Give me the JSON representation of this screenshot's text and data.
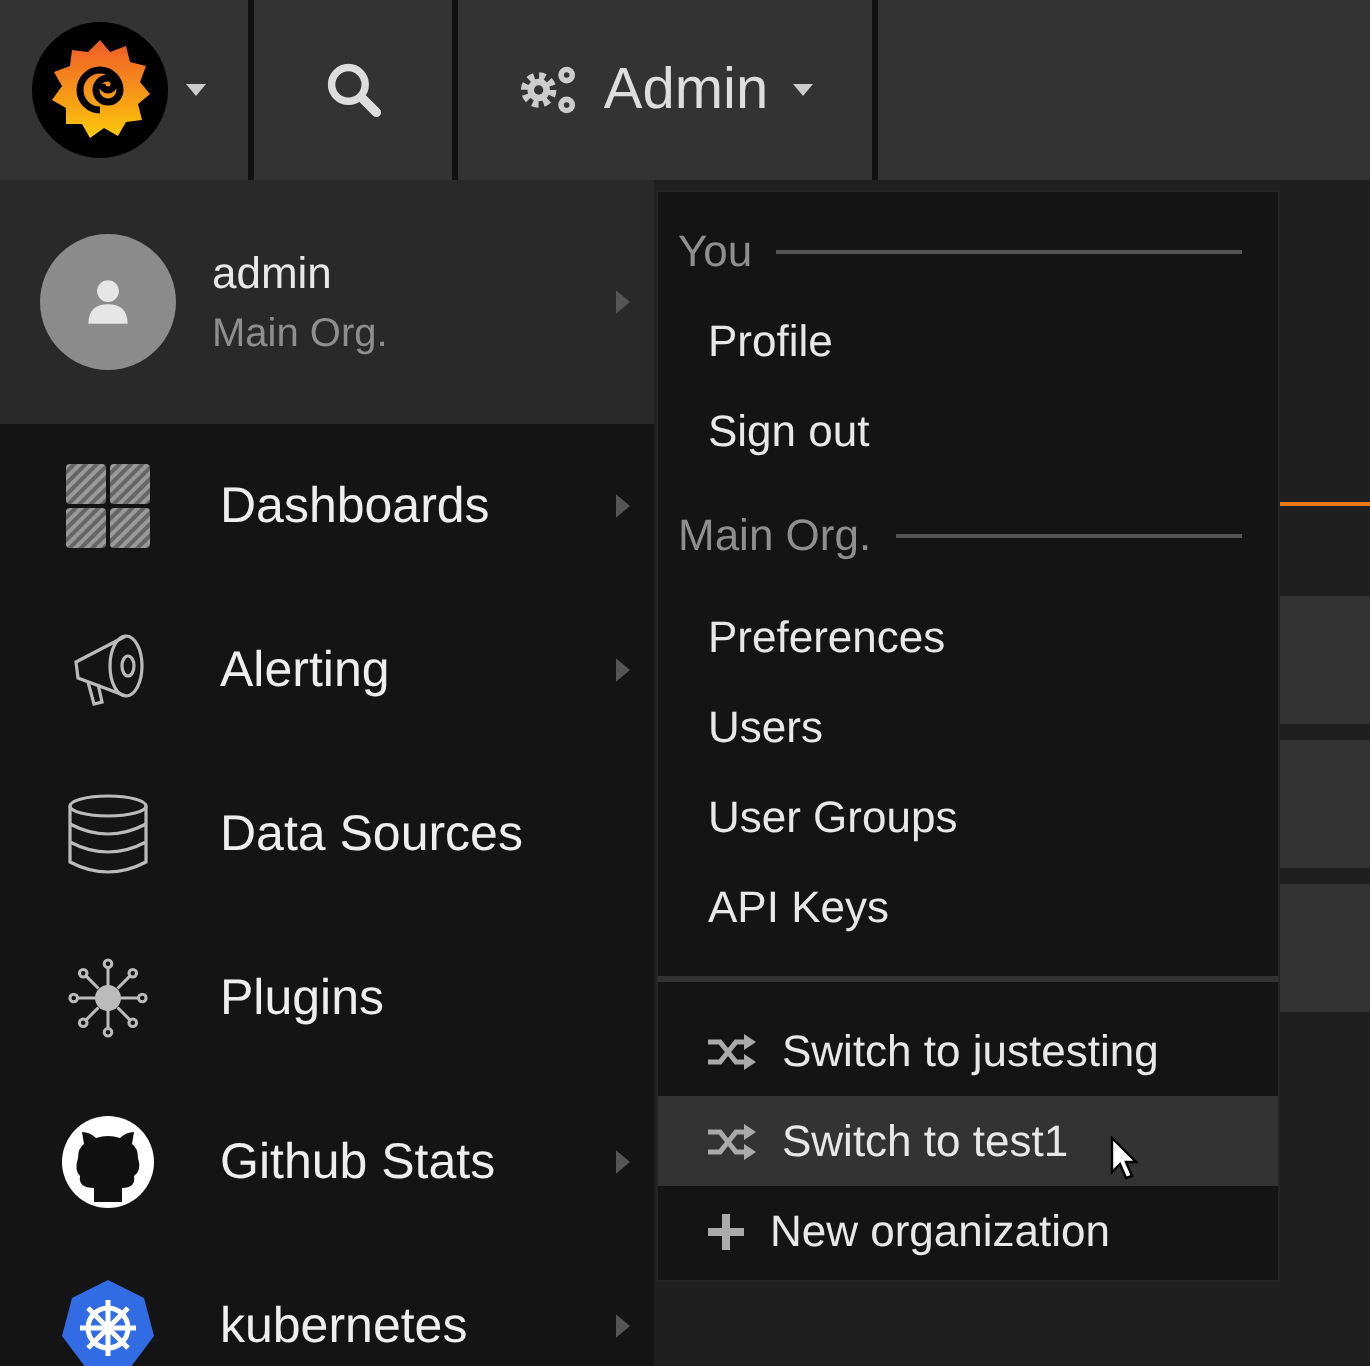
{
  "navbar": {
    "menu": "Admin"
  },
  "profile": {
    "name": "admin",
    "org": "Main Org.",
    "has_submenu": true
  },
  "sidebar": {
    "items": [
      {
        "label": "Dashboards",
        "kind": "dashboards",
        "has_submenu": true
      },
      {
        "label": "Alerting",
        "kind": "alerting",
        "has_submenu": true
      },
      {
        "label": "Data Sources",
        "kind": "datasources",
        "has_submenu": false
      },
      {
        "label": "Plugins",
        "kind": "plugins",
        "has_submenu": false
      },
      {
        "label": "Github Stats",
        "kind": "github",
        "has_submenu": true
      },
      {
        "label": "kubernetes",
        "kind": "kubernetes",
        "has_submenu": true
      }
    ]
  },
  "dropdown": {
    "sections": [
      {
        "header": "You",
        "items": [
          {
            "label": "Profile"
          },
          {
            "label": "Sign out"
          }
        ]
      },
      {
        "header": "Main Org.",
        "items": [
          {
            "label": "Preferences"
          },
          {
            "label": "Users"
          },
          {
            "label": "User Groups"
          },
          {
            "label": "API Keys"
          }
        ]
      }
    ],
    "org_items": [
      {
        "label": "Switch to justesting",
        "kind": "switch",
        "selected": false
      },
      {
        "label": "Switch to test1",
        "kind": "switch",
        "selected": true
      },
      {
        "label": "New organization",
        "kind": "new",
        "selected": false
      }
    ]
  }
}
